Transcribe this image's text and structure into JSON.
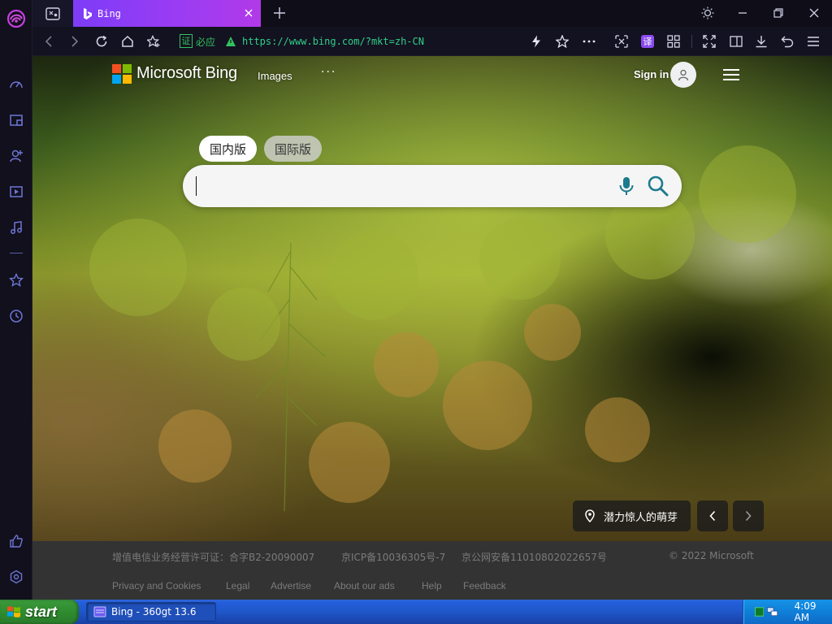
{
  "colors": {
    "accent": "#8a3cf4",
    "url_text": "#2fd08a",
    "cert_green": "#33c25e",
    "footer_bg": "#333333",
    "footer_text": "#7b7b7b",
    "ms_red": "#f25022",
    "ms_green": "#7fba00",
    "ms_blue": "#00a4ef",
    "ms_yellow": "#ffb900",
    "bing_teal": "#1c7b8c"
  },
  "browser": {
    "tab": {
      "title": "Bing",
      "icon": "bing-favicon"
    },
    "sidebar_icons": [
      "speedometer-icon",
      "panel-icon",
      "add-user-icon",
      "video-icon",
      "music-icon",
      "star-icon",
      "history-icon",
      "thumbs-up-icon",
      "settings-icon"
    ],
    "address": {
      "cert_label": "证",
      "site_name": "必应",
      "url": "https://www.bing.com/?mkt=zh-CN"
    },
    "translate_label": "译"
  },
  "bing": {
    "brand": "Microsoft Bing",
    "nav_images": "Images",
    "nav_more": "···",
    "sign_in": "Sign in",
    "region_tabs": {
      "domestic": "国内版",
      "international": "国际版"
    },
    "search_value": "",
    "image_caption": "潜力惊人的萌芽"
  },
  "footer": {
    "line1": [
      "增值电信业务经营许可证：合字B2-20090007",
      "京ICP备10036305号-7",
      "京公网安备11010802022657号",
      "© 2022 Microsoft"
    ],
    "links": [
      "Privacy and Cookies",
      "Legal",
      "Advertise",
      "About our ads",
      "Help",
      "Feedback"
    ]
  },
  "taskbar": {
    "start": "start",
    "task_label": "Bing - 360gt 13.6",
    "clock": "4:09 AM"
  }
}
